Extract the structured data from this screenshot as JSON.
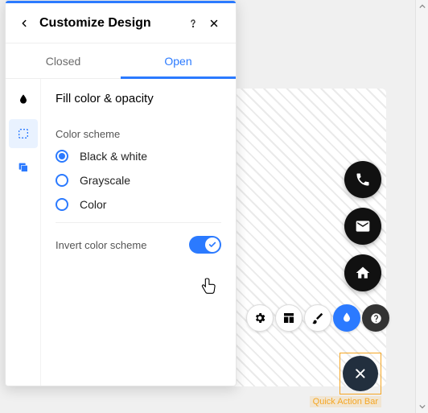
{
  "panel": {
    "title": "Customize Design",
    "tabs": {
      "closed": "Closed",
      "open": "Open"
    },
    "section_title": "Fill color & opacity",
    "color_scheme_label": "Color scheme",
    "options": {
      "bw": "Black & white",
      "gray": "Grayscale",
      "color": "Color"
    },
    "invert_label": "Invert color scheme"
  },
  "quick_action_bar_label": "Quick Action Bar"
}
